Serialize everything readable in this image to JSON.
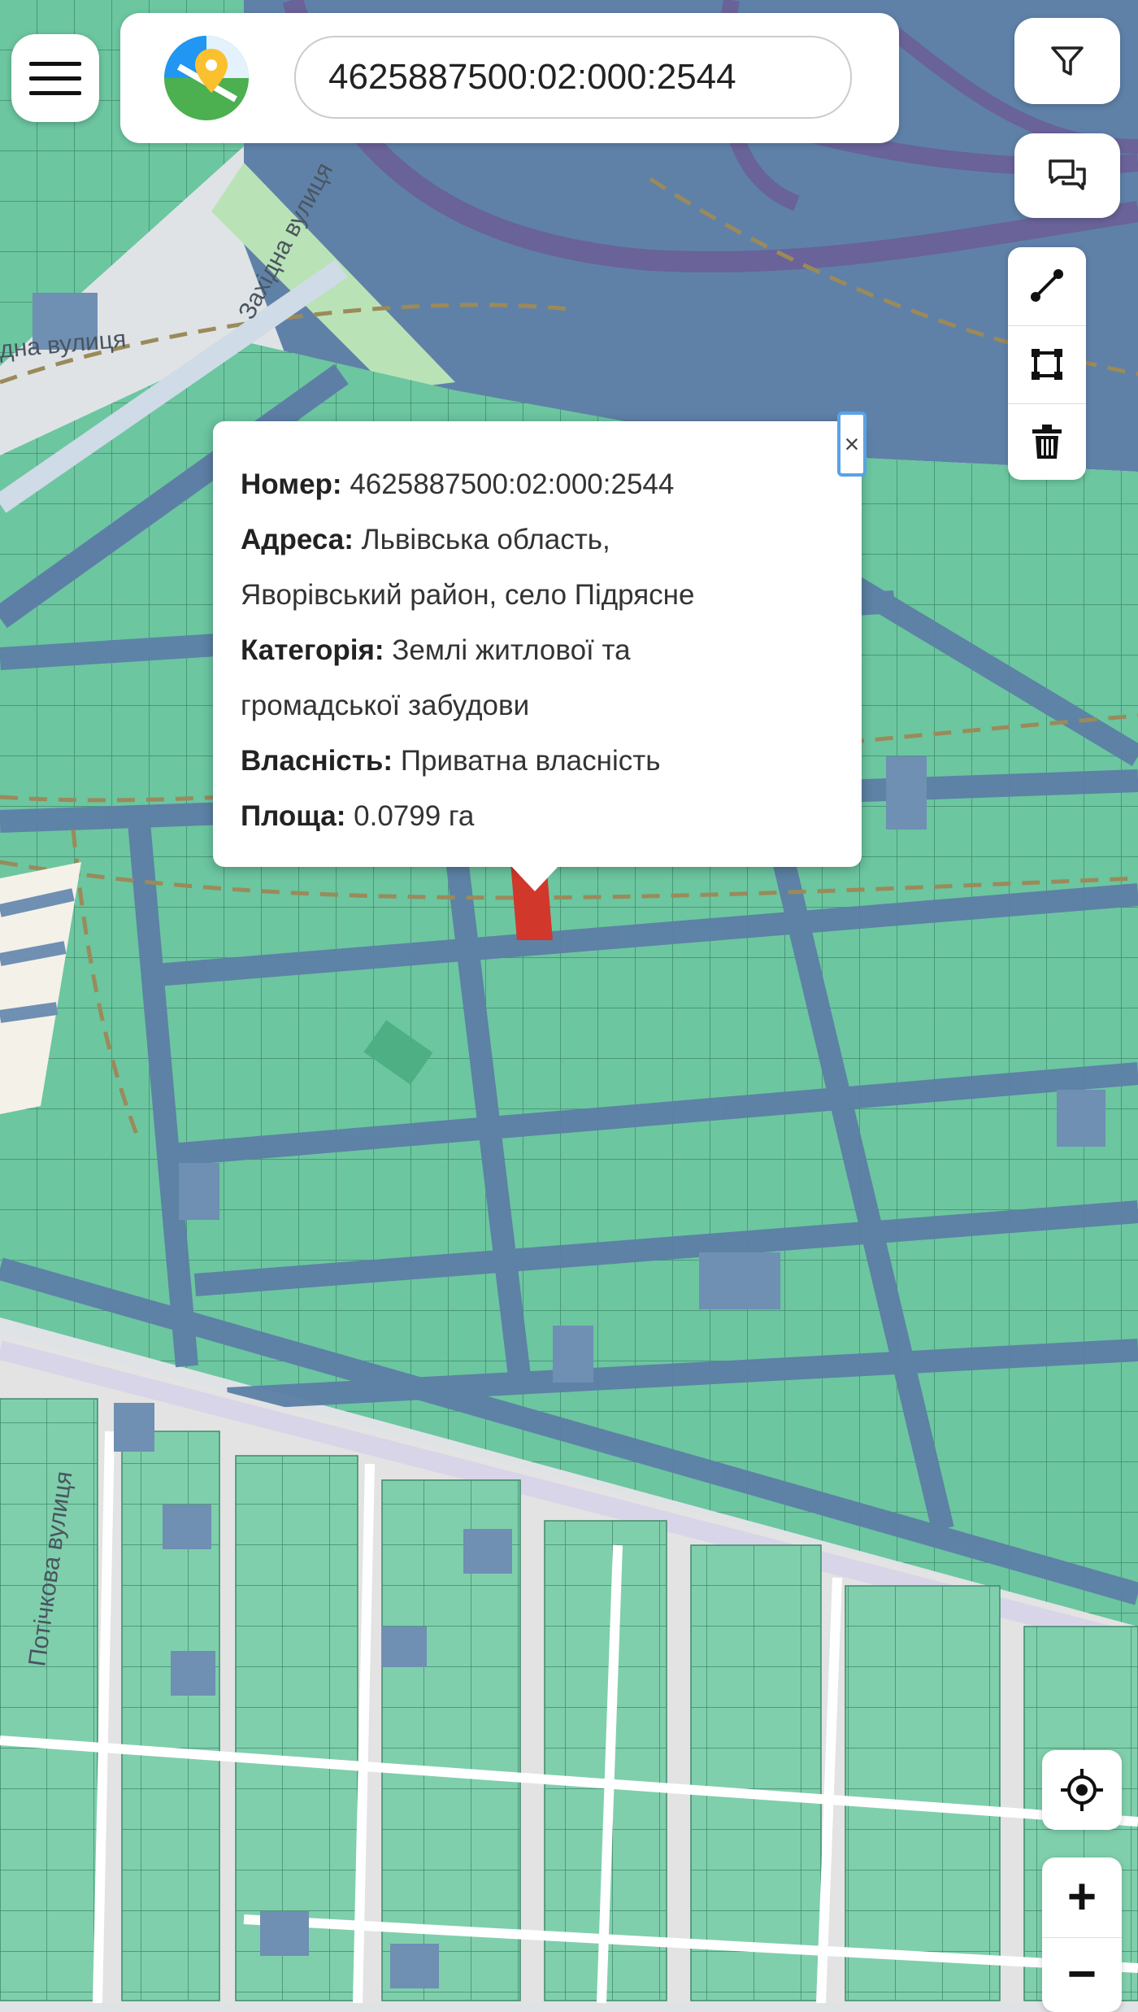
{
  "header": {
    "search_value": "4625887500:02:000:2544"
  },
  "map": {
    "street_labels": [
      "Західна вулиця",
      "дна вулиця",
      "Потічкова вулиця"
    ],
    "colors": {
      "parcel_green": "#6cc6a0",
      "parcel_blue": "#6f8fb3",
      "road_blue": "#5d7fa6",
      "selected_parcel": "#d2372c",
      "base_gray": "#dfe3e6"
    }
  },
  "popup": {
    "number_label": "Номер:",
    "number_value": "4625887500:02:000:2544",
    "address_label": "Адреса:",
    "address_value_line1": "Львівська область,",
    "address_value_line2": "Яворівський район, село Підрясне",
    "category_label": "Категорія:",
    "category_value_line1": "Землі житлової та",
    "category_value_line2": "громадської забудови",
    "ownership_label": "Власність:",
    "ownership_value": "Приватна власність",
    "area_label": "Площа:",
    "area_value": "0.0799 га",
    "close_symbol": "×"
  },
  "controls": {
    "icons": [
      "menu-icon",
      "logo-pin-icon",
      "filter-icon",
      "chat-icon",
      "line-draw-icon",
      "polygon-draw-icon",
      "trash-icon",
      "locate-icon",
      "zoom-in-icon",
      "zoom-out-icon"
    ],
    "zoom_in_symbol": "+",
    "zoom_out_symbol": "−"
  }
}
